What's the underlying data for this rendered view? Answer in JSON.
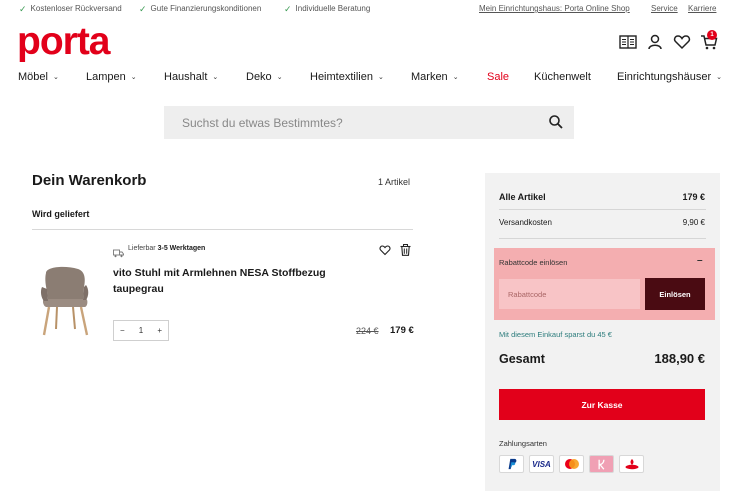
{
  "topbar": {
    "usps": [
      "Kostenloser Rückversand",
      "Gute Finanzierungskonditionen",
      "Individuelle Beratung"
    ],
    "links": [
      "Mein Einrichtungshaus: Porta Online Shop",
      "Service",
      "Karriere"
    ]
  },
  "brand": {
    "logo": "porta",
    "color": "#e2001a"
  },
  "header": {
    "cart_badge": "1",
    "icons": [
      "catalog-icon",
      "account-icon",
      "wishlist-icon",
      "cart-icon"
    ]
  },
  "nav": {
    "items": [
      "Möbel",
      "Lampen",
      "Haushalt",
      "Deko",
      "Heimtextilien",
      "Marken",
      "Sale",
      "Küchenwelt",
      "Einrichtungshäuser"
    ]
  },
  "search": {
    "placeholder": "Suchst du etwas Bestimmtes?"
  },
  "cart": {
    "title": "Dein Warenkorb",
    "count": "1 Artikel",
    "delivery_group": "Wird geliefert",
    "item": {
      "availability_prefix": "Lieferbar",
      "availability_days": "3-5 Werktagen",
      "name": "vito Stuhl mit Armlehnen NESA Stoffbezug taupegrau",
      "quantity": "1",
      "minus": "−",
      "plus": "+",
      "old_price": "224 €",
      "price": "179 €"
    }
  },
  "summary": {
    "all_items_label": "Alle Artikel",
    "all_items_value": "179 €",
    "shipping_label": "Versandkosten",
    "shipping_value": "9,90 €",
    "coupon_title": "Rabattcode einlösen",
    "coupon_toggle": "–",
    "coupon_placeholder": "Rabattcode",
    "coupon_button": "Einlösen",
    "savings": "Mit diesem Einkauf sparst du 45 €",
    "total_label": "Gesamt",
    "total_value": "188,90 €",
    "checkout_button": "Zur Kasse",
    "payment_title": "Zahlungsarten",
    "payment_methods": [
      "paypal-icon",
      "visa-icon",
      "mastercard-icon",
      "klarna-icon",
      "santander-icon"
    ]
  }
}
